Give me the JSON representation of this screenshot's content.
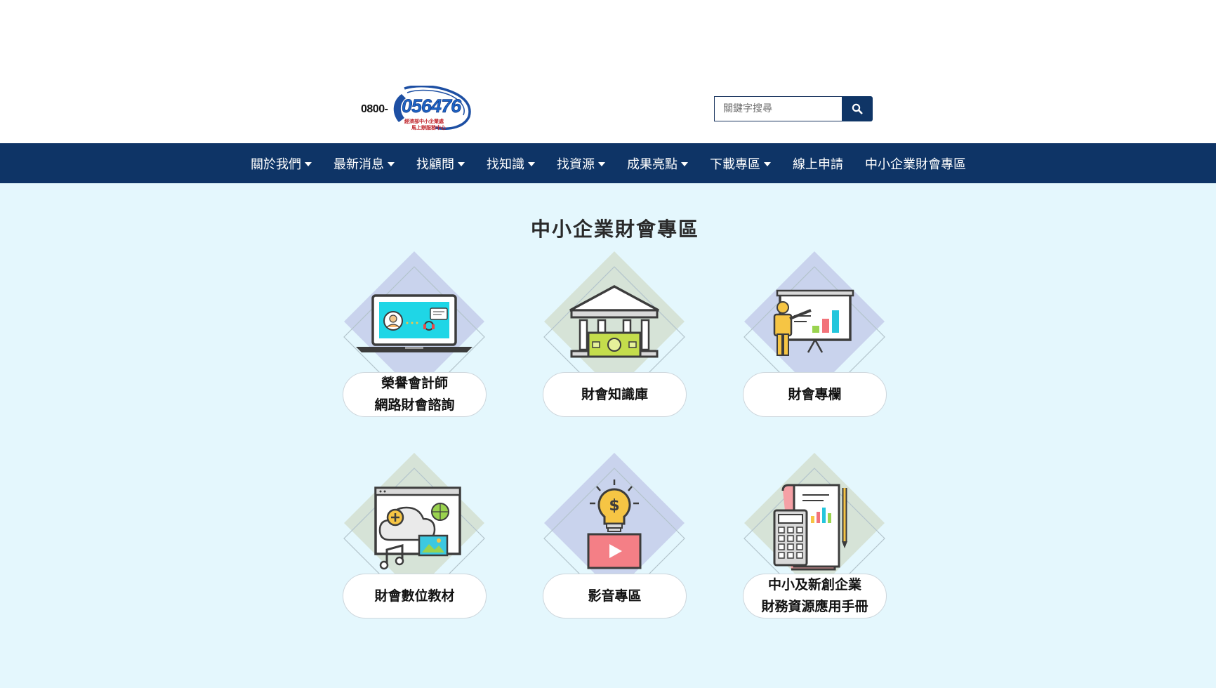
{
  "logo": {
    "prefix": "0800-",
    "number": "056476",
    "subtitle_line1": "經濟部中小企業處",
    "subtitle_line2": "馬上辦服務中心"
  },
  "search": {
    "placeholder": "關鍵字搜尋",
    "icon": "search-icon"
  },
  "nav": {
    "items": [
      {
        "label": "關於我們",
        "dropdown": true
      },
      {
        "label": "最新消息",
        "dropdown": true
      },
      {
        "label": "找顧問",
        "dropdown": true
      },
      {
        "label": "找知識",
        "dropdown": true
      },
      {
        "label": "找資源",
        "dropdown": true
      },
      {
        "label": "成果亮點",
        "dropdown": true
      },
      {
        "label": "下載專區",
        "dropdown": true
      },
      {
        "label": "線上申請",
        "dropdown": false
      },
      {
        "label": "中小企業財會專區",
        "dropdown": false
      }
    ]
  },
  "main": {
    "title": "中小企業財會專區",
    "cards": [
      {
        "line1": "榮譽會計師",
        "line2": "網路財會諮詢",
        "icon": "laptop-consultation-icon",
        "tile_color": "#c9d3ed"
      },
      {
        "line1": "財會知識庫",
        "line2": "",
        "icon": "bank-money-icon",
        "tile_color": "#d6e3d7"
      },
      {
        "line1": "財會專欄",
        "line2": "",
        "icon": "presentation-board-icon",
        "tile_color": "#c9d3ed"
      },
      {
        "line1": "財會數位教材",
        "line2": "",
        "icon": "cloud-media-icon",
        "tile_color": "#d6e3d7"
      },
      {
        "line1": "影音專區",
        "line2": "",
        "icon": "idea-video-icon",
        "tile_color": "#c9d3ed"
      },
      {
        "line1": "中小及新創企業",
        "line2": "財務資源應用手冊",
        "icon": "calculator-document-icon",
        "tile_color": "#d6e3d7"
      }
    ]
  },
  "colors": {
    "nav_bg": "#0e3466",
    "page_bg": "#e4f7fd",
    "header_bg": "#ffffff",
    "search_button_bg": "#0f3566"
  }
}
